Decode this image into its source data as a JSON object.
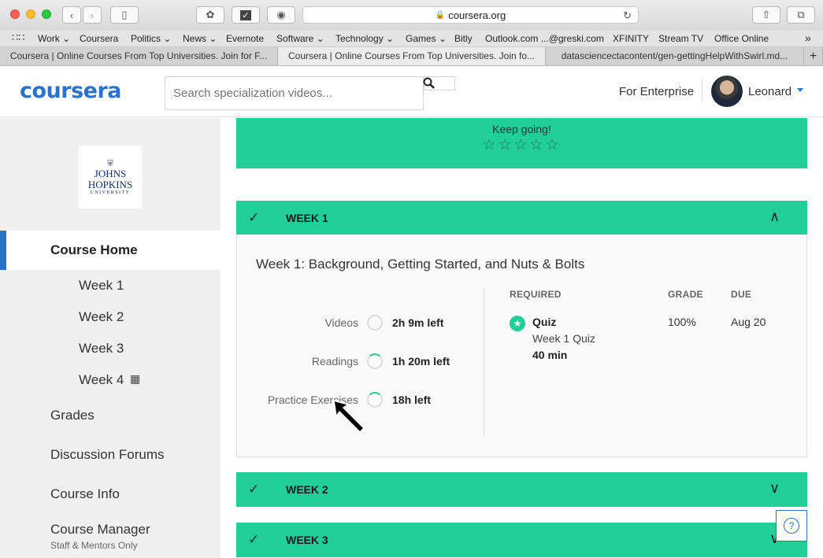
{
  "browser": {
    "url": "coursera.org",
    "bookmarks": [
      "Work",
      "Coursera",
      "Politics",
      "News",
      "Evernote",
      "Software",
      "Technology",
      "Games",
      "Bitly",
      "Outlook.com ...@greski.com",
      "XFINITY",
      "Stream TV",
      "Office Online"
    ],
    "tabs": [
      {
        "title": "Coursera | Online Courses From Top Universities. Join for F...",
        "active": false
      },
      {
        "title": "Coursera | Online Courses From Top Universities. Join fo...",
        "active": true
      },
      {
        "title": "datasciencectacontent/gen-gettingHelpWithSwirl.md...",
        "active": false
      }
    ]
  },
  "header": {
    "logo": "coursera",
    "search_placeholder": "Search specialization videos...",
    "enterprise": "For Enterprise",
    "user_name": "Leonard"
  },
  "sidebar": {
    "university": {
      "line1": "JOHNS",
      "line2": "HOPKINS",
      "line3": "UNIVERSITY"
    },
    "active_item": "Course Home",
    "weeks": [
      "Week 1",
      "Week 2",
      "Week 3",
      "Week 4"
    ],
    "items": [
      "Grades",
      "Discussion Forums",
      "Course Info",
      "Course Manager"
    ],
    "manager_sub": "Staff & Mentors Only"
  },
  "main": {
    "keep_going": "Keep going!",
    "stars": "☆☆☆☆☆",
    "week1": {
      "label": "WEEK 1",
      "title": "Week 1: Background, Getting Started, and Nuts & Bolts",
      "progress": [
        {
          "label": "Videos",
          "value": "2h 9m left",
          "fraction": 0.0
        },
        {
          "label": "Readings",
          "value": "1h 20m left",
          "fraction": 0.15
        },
        {
          "label": "Practice Exercises",
          "value": "18h left",
          "fraction": 0.15
        }
      ],
      "columns": {
        "required": "REQUIRED",
        "grade": "GRADE",
        "due": "DUE"
      },
      "assignment": {
        "type": "Quiz",
        "name": "Week 1 Quiz",
        "duration": "40 min",
        "grade": "100%",
        "due": "Aug 20"
      }
    },
    "week2": {
      "label": "WEEK 2"
    },
    "week3": {
      "label": "WEEK 3"
    },
    "help": "?"
  },
  "colors": {
    "accent": "#2a73cc",
    "green": "#1fcf96"
  }
}
